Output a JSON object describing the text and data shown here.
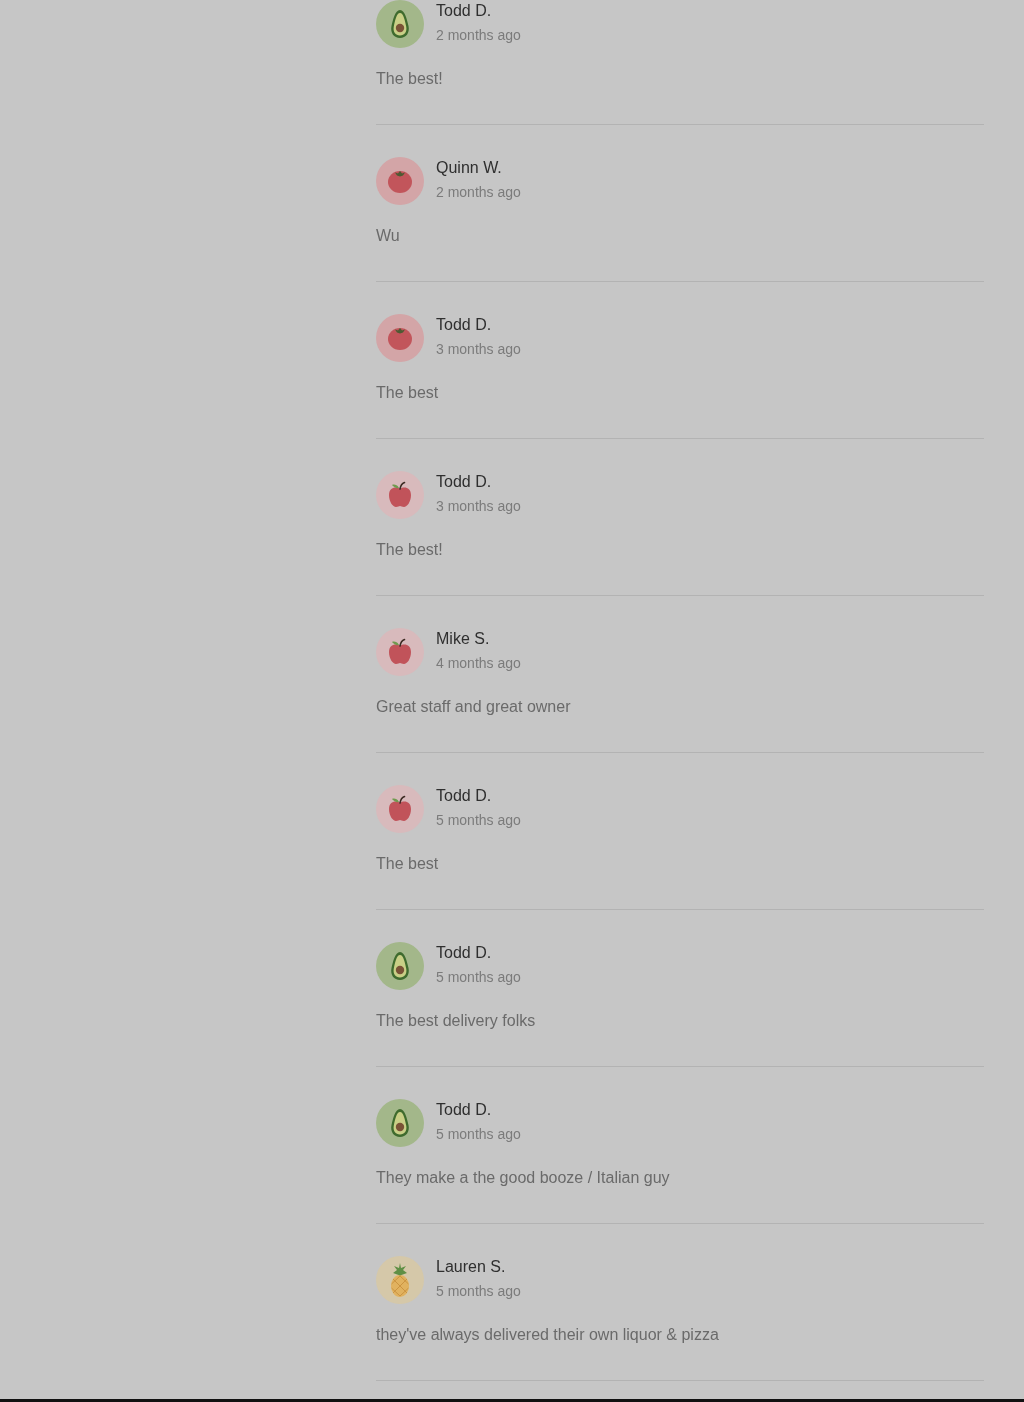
{
  "reviews": [
    {
      "avatar": {
        "kind": "avocado"
      },
      "author": "Todd D.",
      "time": "2 months ago",
      "text": "The best!"
    },
    {
      "avatar": {
        "kind": "tomato"
      },
      "author": "Quinn W.",
      "time": "2 months ago",
      "text": "Wu"
    },
    {
      "avatar": {
        "kind": "tomato"
      },
      "author": "Todd D.",
      "time": "3 months ago",
      "text": "The best"
    },
    {
      "avatar": {
        "kind": "apple"
      },
      "author": "Todd D.",
      "time": "3 months ago",
      "text": "The best!"
    },
    {
      "avatar": {
        "kind": "apple"
      },
      "author": "Mike S.",
      "time": "4 months ago",
      "text": "Great staff and great owner"
    },
    {
      "avatar": {
        "kind": "apple"
      },
      "author": "Todd D.",
      "time": "5 months ago",
      "text": "The best"
    },
    {
      "avatar": {
        "kind": "avocado"
      },
      "author": "Todd D.",
      "time": "5 months ago",
      "text": "The best delivery folks"
    },
    {
      "avatar": {
        "kind": "avocado"
      },
      "author": "Todd D.",
      "time": "5 months ago",
      "text": "They make a the good booze / Italian guy"
    },
    {
      "avatar": {
        "kind": "pineapple"
      },
      "author": "Lauren S.",
      "time": "5 months ago",
      "text": "they've always delivered their own liquor & pizza"
    }
  ]
}
